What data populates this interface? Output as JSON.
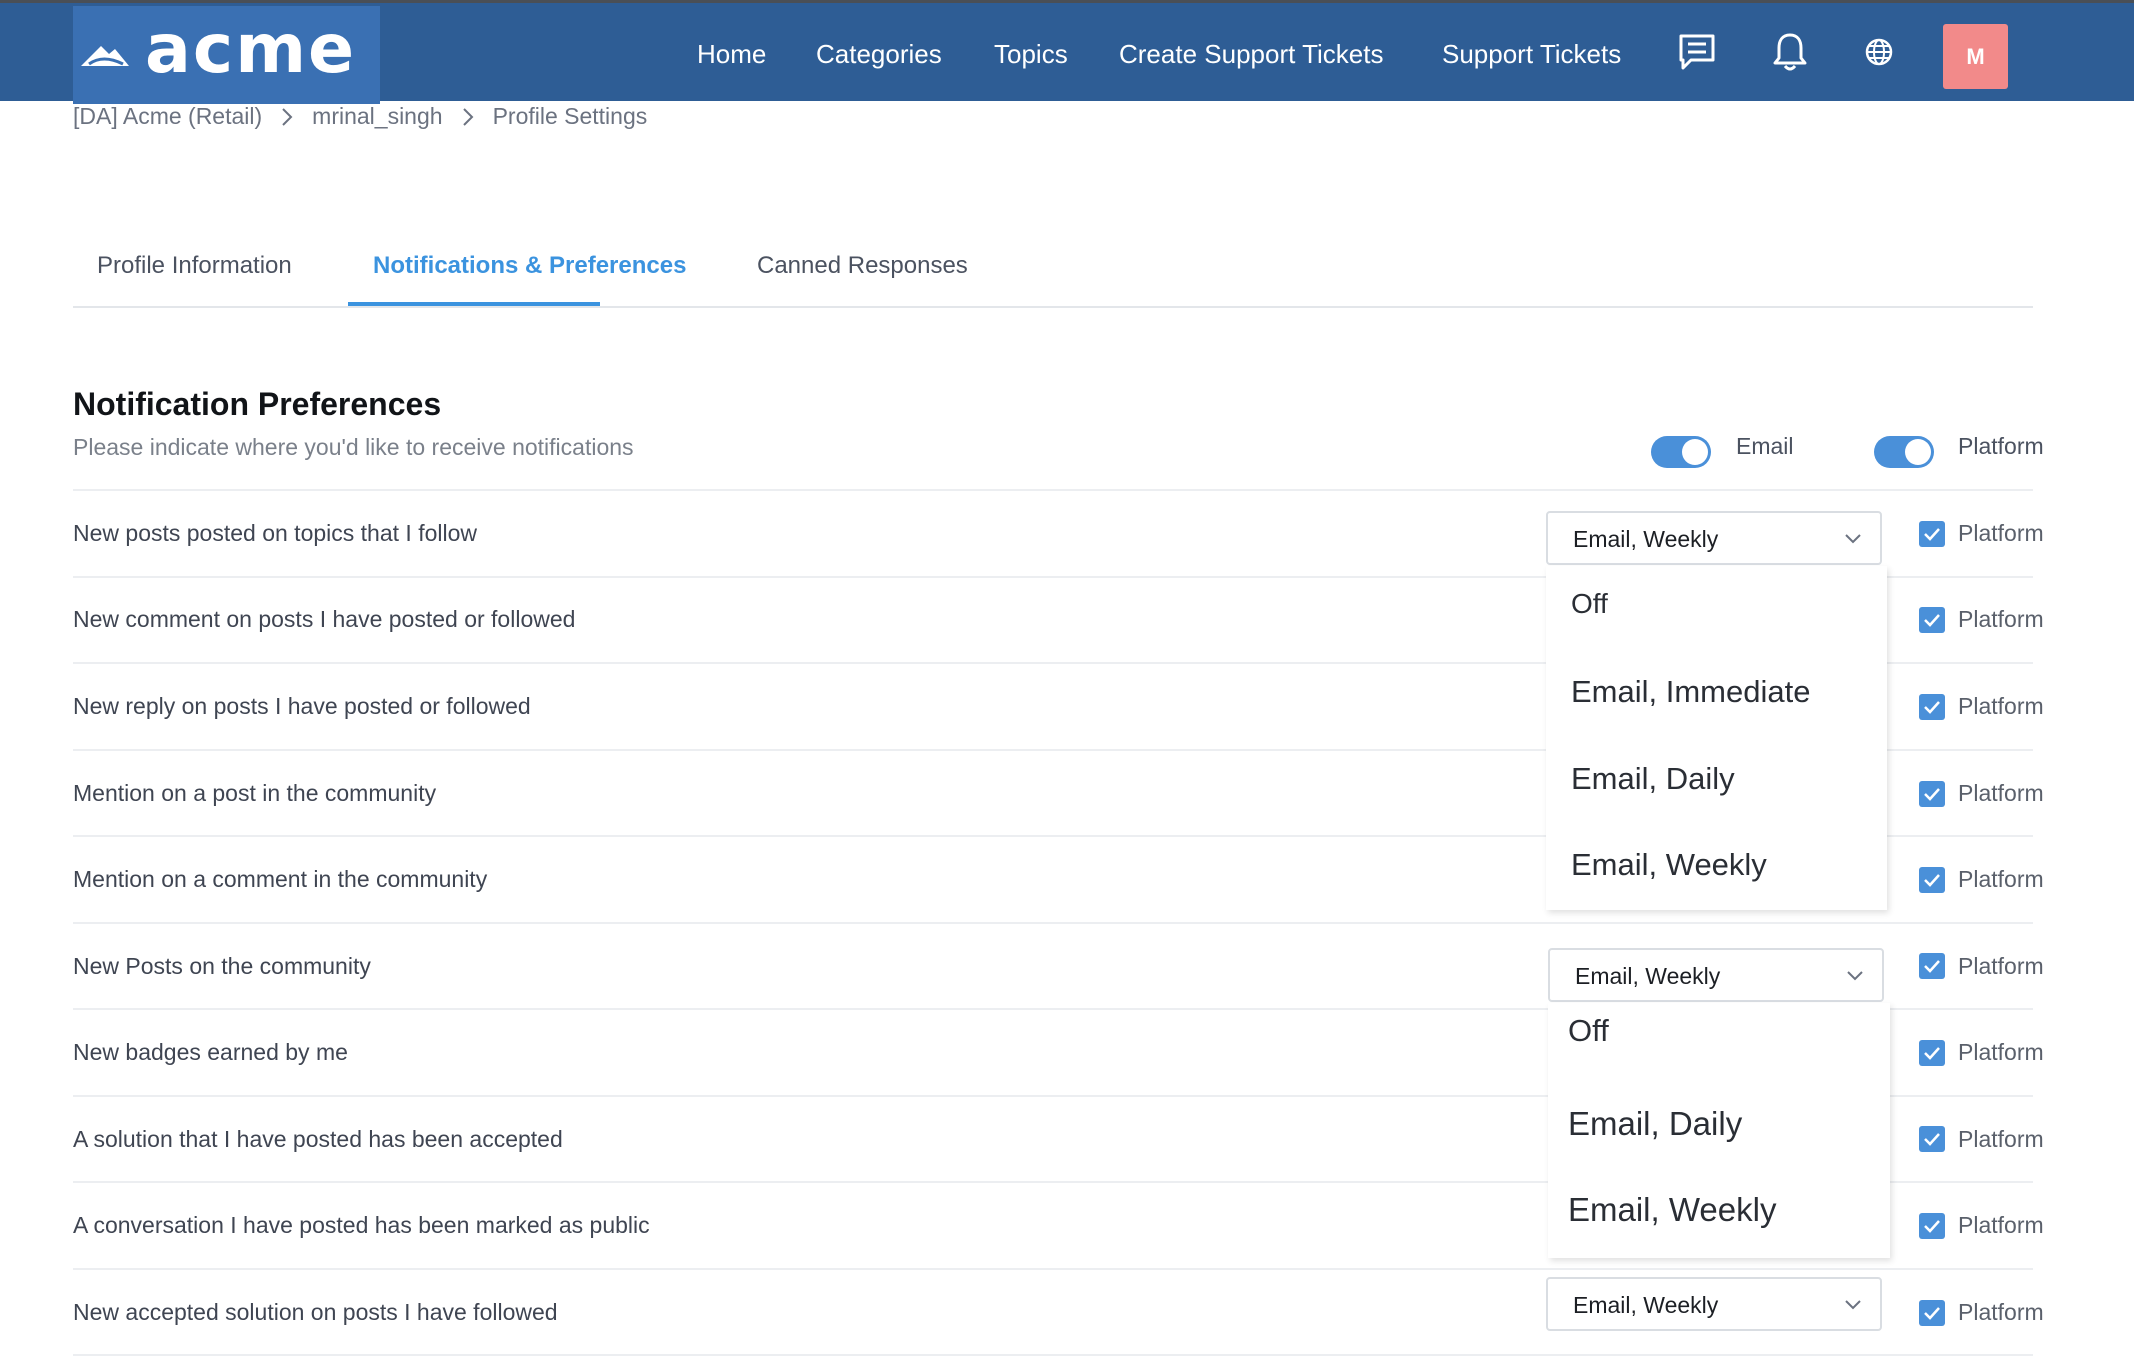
{
  "header": {
    "logo_text": "acme",
    "nav": [
      "Home",
      "Categories",
      "Topics",
      "Create Support Tickets",
      "Support Tickets"
    ],
    "icons": [
      "chat-icon",
      "bell-icon",
      "globe-icon"
    ],
    "avatar_initial": "M",
    "colors": {
      "bar": "#2e5d95",
      "logo_bg": "#3a70b3",
      "avatar": "#f28a8a"
    }
  },
  "breadcrumb": [
    "[DA] Acme (Retail)",
    "mrinal_singh",
    "Profile Settings"
  ],
  "tabs": {
    "items": [
      "Profile Information",
      "Notifications & Preferences",
      "Canned Responses"
    ],
    "active": "Notifications & Preferences"
  },
  "section": {
    "title": "Notification Preferences",
    "subtitle": "Please indicate where you'd like to receive notifications",
    "toggles": [
      {
        "label": "Email",
        "on": true
      },
      {
        "label": "Platform",
        "on": true
      }
    ]
  },
  "rows": [
    {
      "label": "New posts posted on topics that I follow",
      "platform_label": "Platform",
      "platform_checked": true
    },
    {
      "label": "New comment on posts I have posted or followed",
      "platform_label": "Platform",
      "platform_checked": true
    },
    {
      "label": "New reply on posts I have posted or followed",
      "platform_label": "Platform",
      "platform_checked": true
    },
    {
      "label": "Mention on a post in the community",
      "platform_label": "Platform",
      "platform_checked": true
    },
    {
      "label": "Mention on a comment in the community",
      "platform_label": "Platform",
      "platform_checked": true
    },
    {
      "label": "New Posts on the community",
      "platform_label": "Platform",
      "platform_checked": true
    },
    {
      "label": "New badges earned by me",
      "platform_label": "Platform",
      "platform_checked": true
    },
    {
      "label": "A solution that I have posted has been accepted",
      "platform_label": "Platform",
      "platform_checked": true
    },
    {
      "label": "A conversation I have posted has been marked as public",
      "platform_label": "Platform",
      "platform_checked": true
    },
    {
      "label": "New accepted solution on posts I have followed",
      "platform_label": "Platform",
      "platform_checked": true
    }
  ],
  "selects": [
    {
      "value": "Email, Weekly",
      "options": [
        "Off",
        "Email, Immediate",
        "Email, Daily",
        "Email, Weekly"
      ]
    },
    {
      "value": "Email, Weekly",
      "options": [
        "Off",
        "Email, Daily",
        "Email, Weekly"
      ]
    },
    {
      "value": "Email, Weekly"
    }
  ],
  "accent": "#3b93df"
}
